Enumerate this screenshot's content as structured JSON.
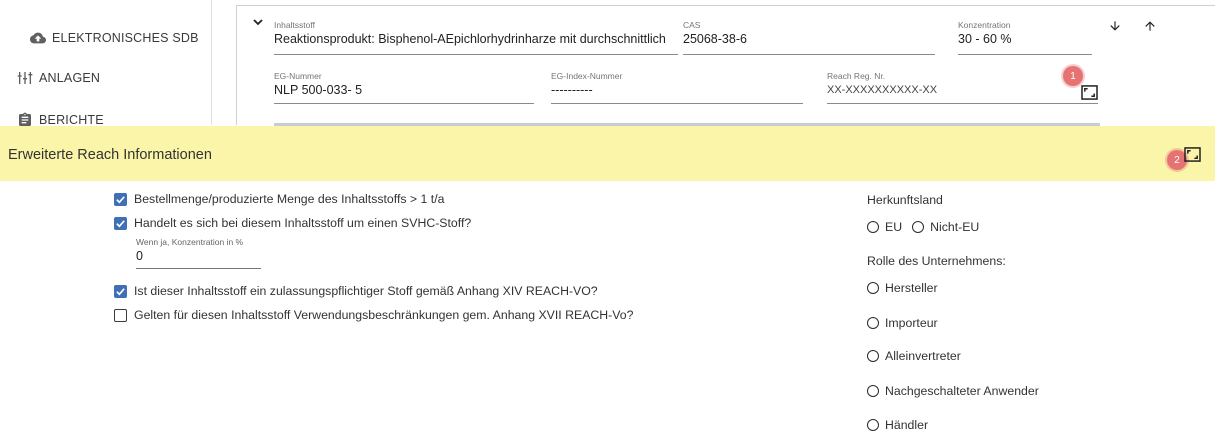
{
  "sidebar": {
    "items": [
      {
        "label": "ELEKTRONISCHES SDB",
        "icon": "cloud-upload-icon"
      },
      {
        "label": "ANLAGEN",
        "icon": "equalizer-icon"
      },
      {
        "label": "BERICHTE",
        "icon": "clipboard-icon"
      }
    ]
  },
  "ingredient": {
    "inhaltsstoff_label": "Inhaltsstoff",
    "inhaltsstoff_value": "Reaktionsprodukt: Bisphenol-AEpichlorhydrinharze mit durchschnittlich",
    "cas_label": "CAS",
    "cas_value": "25068-38-6",
    "konzentration_label": "Konzentration",
    "konzentration_value": "30 - 60 %",
    "eg_nummer_label": "EG-Nummer",
    "eg_nummer_value": "NLP 500-033- 5",
    "eg_index_label": "EG-Index-Nummer",
    "eg_index_value": "----------",
    "reach_label": "Reach Reg. Nr.",
    "reach_value": "XX-XXXXXXXXXX-XX",
    "badge1": "1"
  },
  "section": {
    "title": "Erweiterte Reach Informationen",
    "badge2": "2"
  },
  "checks": [
    {
      "label": "Bestellmenge/produzierte Menge des Inhaltsstoffs > 1 t/a",
      "checked": true
    },
    {
      "label": "Handelt es sich bei diesem Inhaltsstoff um einen SVHC-Stoff?",
      "checked": true
    },
    {
      "label": "Ist dieser Inhaltsstoff ein zulassungspflichtiger Stoff gemäß Anhang XIV REACH-VO?",
      "checked": true
    },
    {
      "label": "Gelten für diesen Inhaltsstoff Verwendungsbeschränkungen gem. Anhang XVII REACH-Vo?",
      "checked": false
    }
  ],
  "svhc": {
    "label": "Wenn ja, Konzentration in %",
    "value": "0"
  },
  "origin": {
    "label": "Herkunftsland",
    "options": [
      "EU",
      "Nicht-EU"
    ]
  },
  "role": {
    "label": "Rolle des Unternehmens:",
    "options": [
      "Hersteller",
      "Importeur",
      "Alleinvertreter",
      "Nachgeschalteter Anwender",
      "Händler"
    ]
  },
  "colors": {
    "header_bg": "#fbf5a9",
    "checkbox_checked": "#3f6fb4",
    "badge": "#e57373"
  }
}
